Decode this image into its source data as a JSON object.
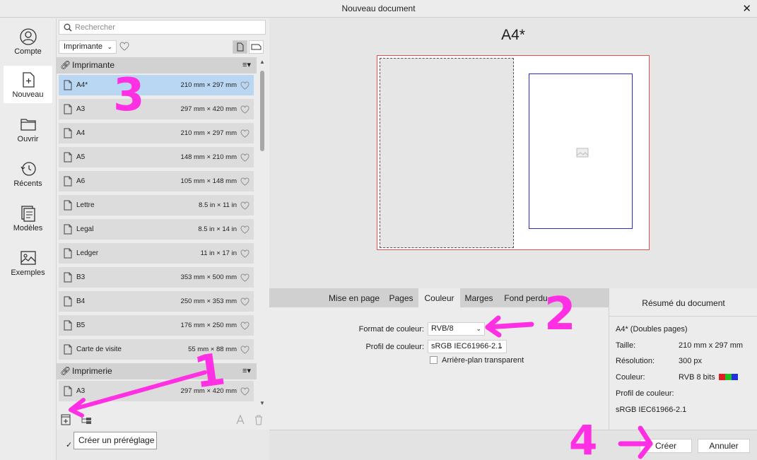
{
  "window": {
    "title": "Nouveau document",
    "close": "✕"
  },
  "nav": {
    "items": [
      {
        "label": "Compte"
      },
      {
        "label": "Nouveau"
      },
      {
        "label": "Ouvrir"
      },
      {
        "label": "Récents"
      },
      {
        "label": "Modèles"
      },
      {
        "label": "Exemples"
      }
    ]
  },
  "presets": {
    "search_placeholder": "Rechercher",
    "filter_value": "Imprimante",
    "groups": [
      {
        "name": "Imprimante",
        "rows": [
          {
            "name": "A4*",
            "size": "210 mm × 297 mm",
            "selected": true
          },
          {
            "name": "A3",
            "size": "297 mm × 420 mm"
          },
          {
            "name": "A4",
            "size": "210 mm × 297 mm"
          },
          {
            "name": "A5",
            "size": "148 mm × 210 mm"
          },
          {
            "name": "A6",
            "size": "105 mm × 148 mm"
          },
          {
            "name": "Lettre",
            "size": "8.5 in × 11 in"
          },
          {
            "name": "Legal",
            "size": "8.5 in × 14 in"
          },
          {
            "name": "Ledger",
            "size": "11 in × 17 in"
          },
          {
            "name": "B3",
            "size": "353 mm × 500 mm"
          },
          {
            "name": "B4",
            "size": "250 mm × 353 mm"
          },
          {
            "name": "B5",
            "size": "176 mm × 250 mm"
          },
          {
            "name": "Carte de visite",
            "size": "55 mm × 88 mm"
          }
        ]
      },
      {
        "name": "Imprimerie",
        "rows": [
          {
            "name": "A3",
            "size": "297 mm × 420 mm"
          }
        ]
      }
    ],
    "tooltip": "Créer un préréglage"
  },
  "preview": {
    "title": "A4*"
  },
  "tabs": [
    {
      "label": "Mise en page"
    },
    {
      "label": "Pages"
    },
    {
      "label": "Couleur",
      "active": true
    },
    {
      "label": "Marges"
    },
    {
      "label": "Fond perdu"
    }
  ],
  "color": {
    "format_label": "Format de couleur:",
    "format_value": "RVB/8",
    "profile_label": "Profil de couleur:",
    "profile_value": "sRGB IEC61966-2.1",
    "transparent_label": "Arrière-plan transparent",
    "transparent_checked": false
  },
  "summary": {
    "title": "Résumé du document",
    "doc": "A4* (Doubles pages)",
    "size_label": "Taille:",
    "size_value": "210 mm  x  297 mm",
    "resolution_label": "Résolution:",
    "resolution_value": "300 px",
    "color_label": "Couleur:",
    "color_value": "RVB 8 bits",
    "profile_label": "Profil de couleur:",
    "profile_value": "sRGB IEC61966-2.1",
    "swatch_colors": [
      "#e02020",
      "#20c020",
      "#2030e0"
    ]
  },
  "footer": {
    "create": "Créer",
    "cancel": "Annuler"
  },
  "annotations": {
    "one": "1",
    "two": "2",
    "three": "3",
    "four": "4"
  },
  "colors": {
    "accent_select": "#b9d7f3",
    "annotation": "#ff2fe3",
    "bleed": "#e35050",
    "page_border": "#2a2acf"
  }
}
